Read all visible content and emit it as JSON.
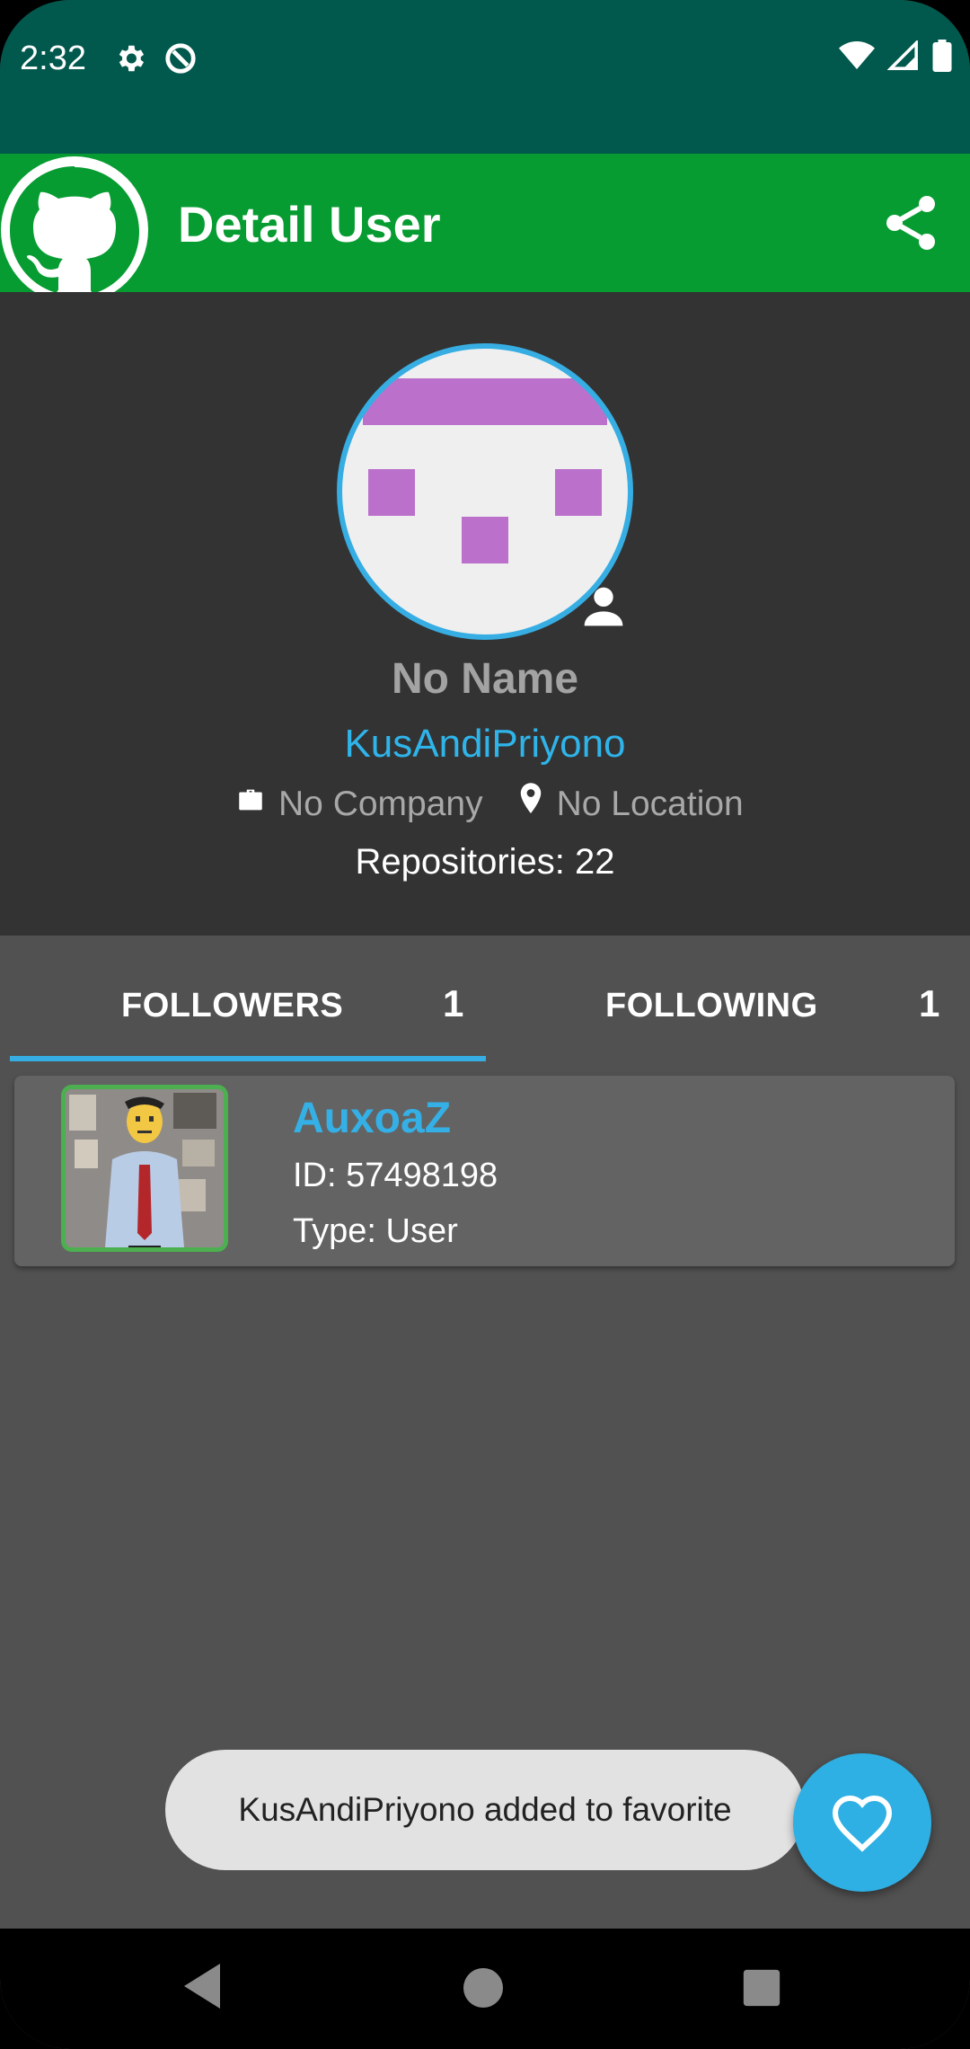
{
  "status_bar": {
    "time": "2:32"
  },
  "app_bar": {
    "title": "Detail User"
  },
  "profile": {
    "name": "No Name",
    "username": "KusAndiPriyono",
    "company": "No Company",
    "location": "No Location",
    "repositories": "Repositories: 22"
  },
  "tabs": [
    {
      "label": "FOLLOWERS",
      "count": "1",
      "selected": true
    },
    {
      "label": "FOLLOWING",
      "count": "1",
      "selected": false
    }
  ],
  "followers": [
    {
      "login": "AuxoaZ",
      "id": "ID: 57498198",
      "type": "Type: User"
    }
  ],
  "snackbar": {
    "message": "KusAndiPriyono added to favorite"
  },
  "colors": {
    "status_bar": "#01584d",
    "app_bar": "#069c31",
    "accent": "#2fb4ea",
    "avatar_identicon": "#bb71cc"
  }
}
